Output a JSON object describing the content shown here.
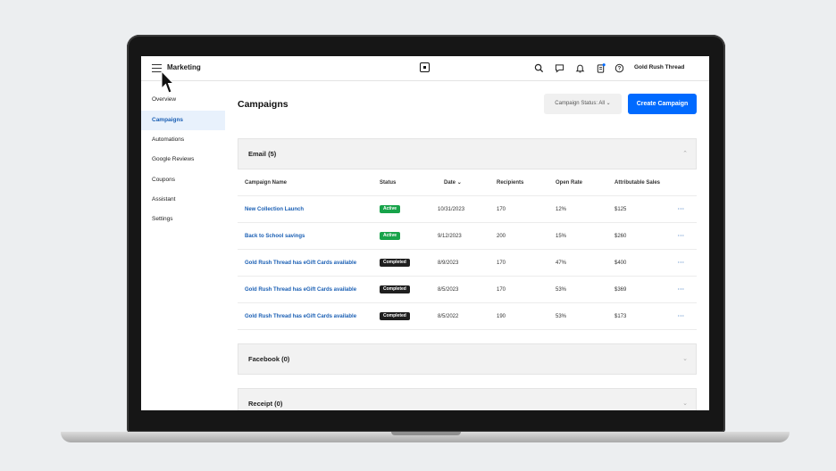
{
  "app": {
    "title": "Marketing",
    "business_name": "Gold Rush Thread"
  },
  "sidebar": {
    "items": [
      {
        "label": "Overview"
      },
      {
        "label": "Campaigns"
      },
      {
        "label": "Automations"
      },
      {
        "label": "Google Reviews"
      },
      {
        "label": "Coupons"
      },
      {
        "label": "Assistant"
      },
      {
        "label": "Settings"
      }
    ]
  },
  "main": {
    "title": "Campaigns",
    "status_filter": "Campaign Status: All",
    "create_label": "Create Campaign"
  },
  "sections": {
    "email": "Email (5)",
    "facebook": "Facebook (0)",
    "receipt": "Receipt (0)"
  },
  "table": {
    "headers": [
      "Campaign Name",
      "Status",
      "Date",
      "Recipients",
      "Open Rate",
      "Attributable Sales"
    ],
    "rows": [
      {
        "name": "New Collection Launch",
        "status": "Active",
        "date": "10/31/2023",
        "recipients": "170",
        "open_rate": "12%",
        "sales": "$125"
      },
      {
        "name": "Back to School savings",
        "status": "Active",
        "date": "9/12/2023",
        "recipients": "200",
        "open_rate": "15%",
        "sales": "$260"
      },
      {
        "name": "Gold Rush Thread has eGift Cards available",
        "status": "Completed",
        "date": "8/9/2023",
        "recipients": "170",
        "open_rate": "47%",
        "sales": "$400"
      },
      {
        "name": "Gold Rush Thread has eGift Cards available",
        "status": "Completed",
        "date": "8/5/2023",
        "recipients": "170",
        "open_rate": "53%",
        "sales": "$369"
      },
      {
        "name": "Gold Rush Thread has eGift Cards available",
        "status": "Completed",
        "date": "8/5/2022",
        "recipients": "190",
        "open_rate": "53%",
        "sales": "$173"
      }
    ],
    "more_label": "···"
  },
  "colors": {
    "accent": "#006aff",
    "active": "#17a34a",
    "completed": "#1f1f1f"
  },
  "icons": [
    "hamburger-icon",
    "square-logo-icon",
    "search-icon",
    "message-icon",
    "bell-icon",
    "clipboard-icon",
    "help-icon",
    "chevron-up-icon",
    "chevron-down-icon",
    "cursor-icon"
  ]
}
